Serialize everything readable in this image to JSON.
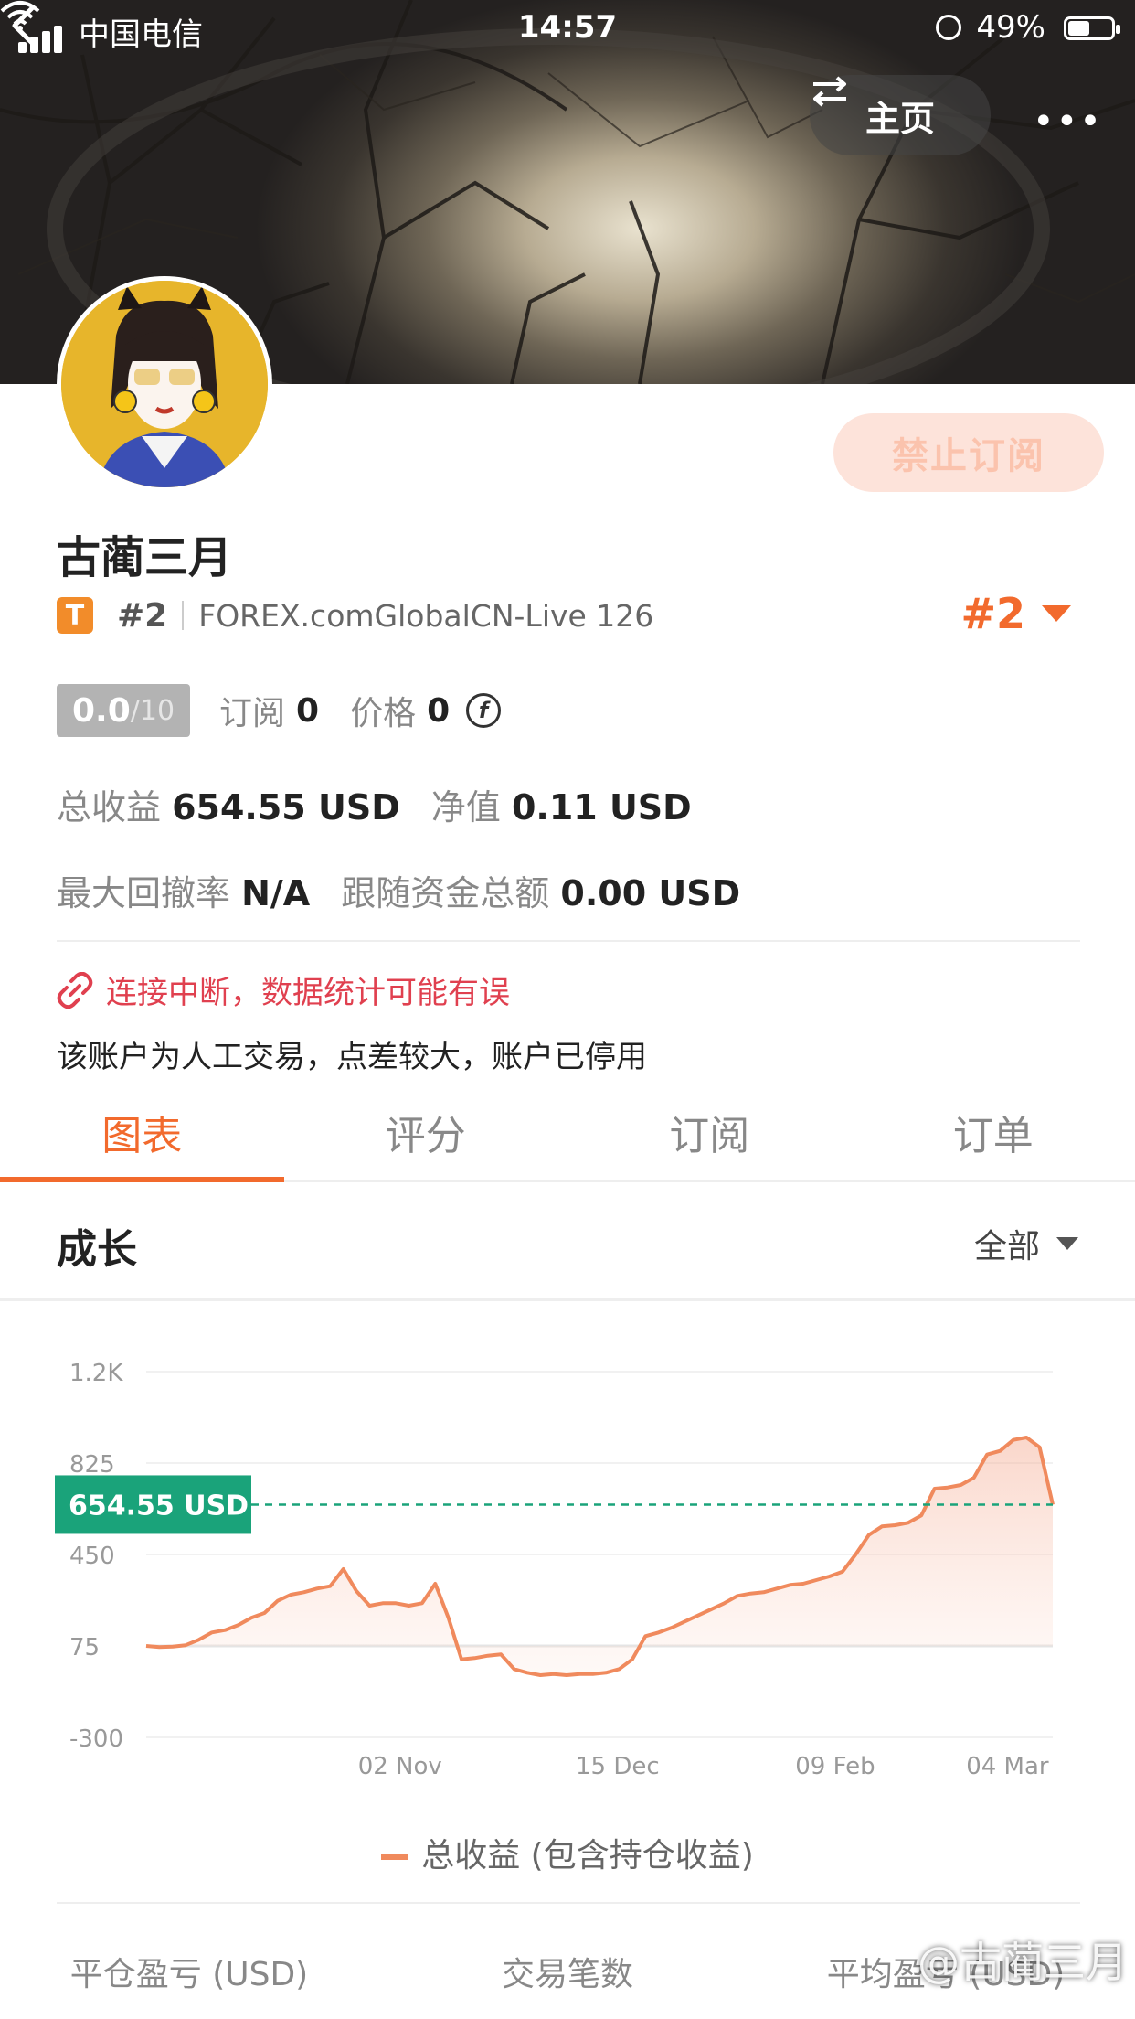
{
  "status_bar": {
    "carrier": "中国电信",
    "time": "14:57",
    "battery": "49%"
  },
  "header": {
    "home_label": "主页",
    "more": "•••"
  },
  "profile": {
    "name": "古蔺三月",
    "badge_letter": "T",
    "rank_small": "#2",
    "server": "FOREX.comGlobalCN-Live 126",
    "rank_big": "#2",
    "subscribe_button": "禁止订阅"
  },
  "stats": {
    "score": "0.0",
    "score_max": "/10",
    "subscribe_label": "订阅",
    "subscribe_value": "0",
    "price_label": "价格",
    "price_value": "0",
    "coin_symbol": "f",
    "total_profit_label": "总收益",
    "total_profit_value": "654.55 USD",
    "equity_label": "净值",
    "equity_value": "0.11 USD",
    "max_drawdown_label": "最大回撤率",
    "max_drawdown_value": "N/A",
    "follow_total_label": "跟随资金总额",
    "follow_total_value": "0.00 USD"
  },
  "alerts": {
    "warning": "连接中断，数据统计可能有误",
    "note": "该账户为人工交易，点差较大，账户已停用"
  },
  "tabs": [
    "图表",
    "评分",
    "订阅",
    "订单"
  ],
  "section": {
    "title": "成长",
    "filter": "全部"
  },
  "chart_data": {
    "type": "area",
    "y_ticks": [
      "1.2K",
      "825",
      "450",
      "75",
      "-300"
    ],
    "ylim": [
      -300,
      1200
    ],
    "x_ticks": [
      "02 Nov",
      "15 Dec",
      "09 Feb",
      "04 Mar"
    ],
    "current_label": "654.55 USD",
    "current_value": 654.55,
    "series": [
      {
        "name": "总收益 (包含持仓收益)",
        "color": "#f08a5d",
        "values": [
          75,
          70,
          72,
          78,
          100,
          130,
          140,
          160,
          190,
          210,
          260,
          285,
          295,
          310,
          320,
          390,
          300,
          240,
          250,
          250,
          240,
          250,
          330,
          190,
          20,
          25,
          35,
          40,
          -20,
          -35,
          -45,
          -40,
          -45,
          -40,
          -40,
          -35,
          -20,
          20,
          115,
          130,
          150,
          175,
          200,
          225,
          250,
          280,
          290,
          295,
          310,
          325,
          330,
          345,
          360,
          380,
          450,
          530,
          565,
          570,
          580,
          610,
          720,
          725,
          735,
          765,
          860,
          875,
          920,
          930,
          890,
          654.55
        ]
      }
    ],
    "legend_position": "bottom-center",
    "grid": true
  },
  "bottom_stats": [
    "平仓盈亏 (USD)",
    "交易笔数",
    "平均盈亏 (USD)"
  ],
  "watermark": "@古蔺三月"
}
